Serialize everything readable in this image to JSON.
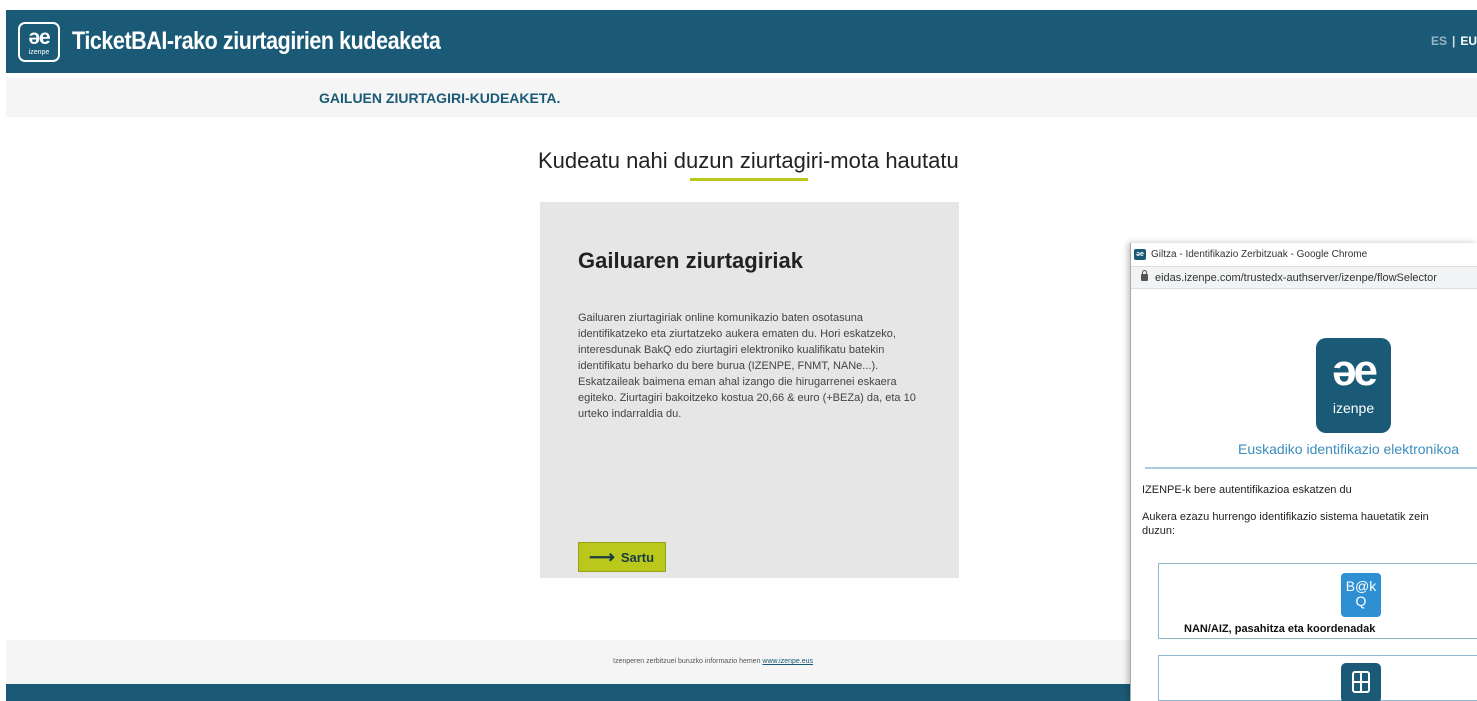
{
  "header": {
    "logo_text": "əe",
    "logo_sub": "izenpe",
    "title": "TicketBAI-rako ziurtagirien kudeaketa",
    "lang_es": "ES",
    "lang_sep": "|",
    "lang_eu": "EU"
  },
  "subheader": {
    "title": "GAILUEN ZIURTAGIRI-KUDEAKETA."
  },
  "main": {
    "heading": "Kudeatu nahi duzun ziurtagiri-mota hautatu",
    "card": {
      "title": "Gailuaren ziurtagiriak",
      "text": "Gailuaren ziurtagiriak online komunikazio baten osotasuna identifikatzeko eta ziurtatzeko aukera ematen du. Hori eskatzeko, interesdunak BakQ edo ziurtagiri elektroniko kualifikatu batekin identifikatu beharko du bere burua (IZENPE, FNMT, NANe...). Eskatzaileak baimena eman ahal izango die hirugarrenei eskaera egiteko. Ziurtagiri bakoitzeko kostua 20,66 & euro (+BEZa) da, eta 10 urteko indarraldia du.",
      "button_arrow": "⟶",
      "button_label": "Sartu"
    }
  },
  "footer": {
    "text": "Izenperen zerbitzuei buruzko informazio hemen",
    "link": "www.izenpe.eus"
  },
  "popup": {
    "favicon": "əe",
    "window_title": "Giltza - Identifikazio Zerbitzuak - Google Chrome",
    "url": "eidas.izenpe.com/trustedx-authserver/izenpe/flowSelector",
    "logo_text": "əe",
    "logo_sub": "izenpe",
    "subtitle": "Euskadiko identifikazio elektronikoa",
    "line1": "IZENPE-k bere autentifikazioa eskatzen du",
    "line2a": "Aukera ezazu hurrengo identifikazio sistema hauetatik zein",
    "line2b": "duzun:",
    "option1_icon_top": "B@k",
    "option1_icon_bottom": "Q",
    "option1_label": "NAN/AIZ, pasahitza eta koordenadak"
  },
  "colors": {
    "brand_dark": "#1b5a76",
    "accent_green": "#b9c81b",
    "link_blue": "#3b8dbd"
  }
}
